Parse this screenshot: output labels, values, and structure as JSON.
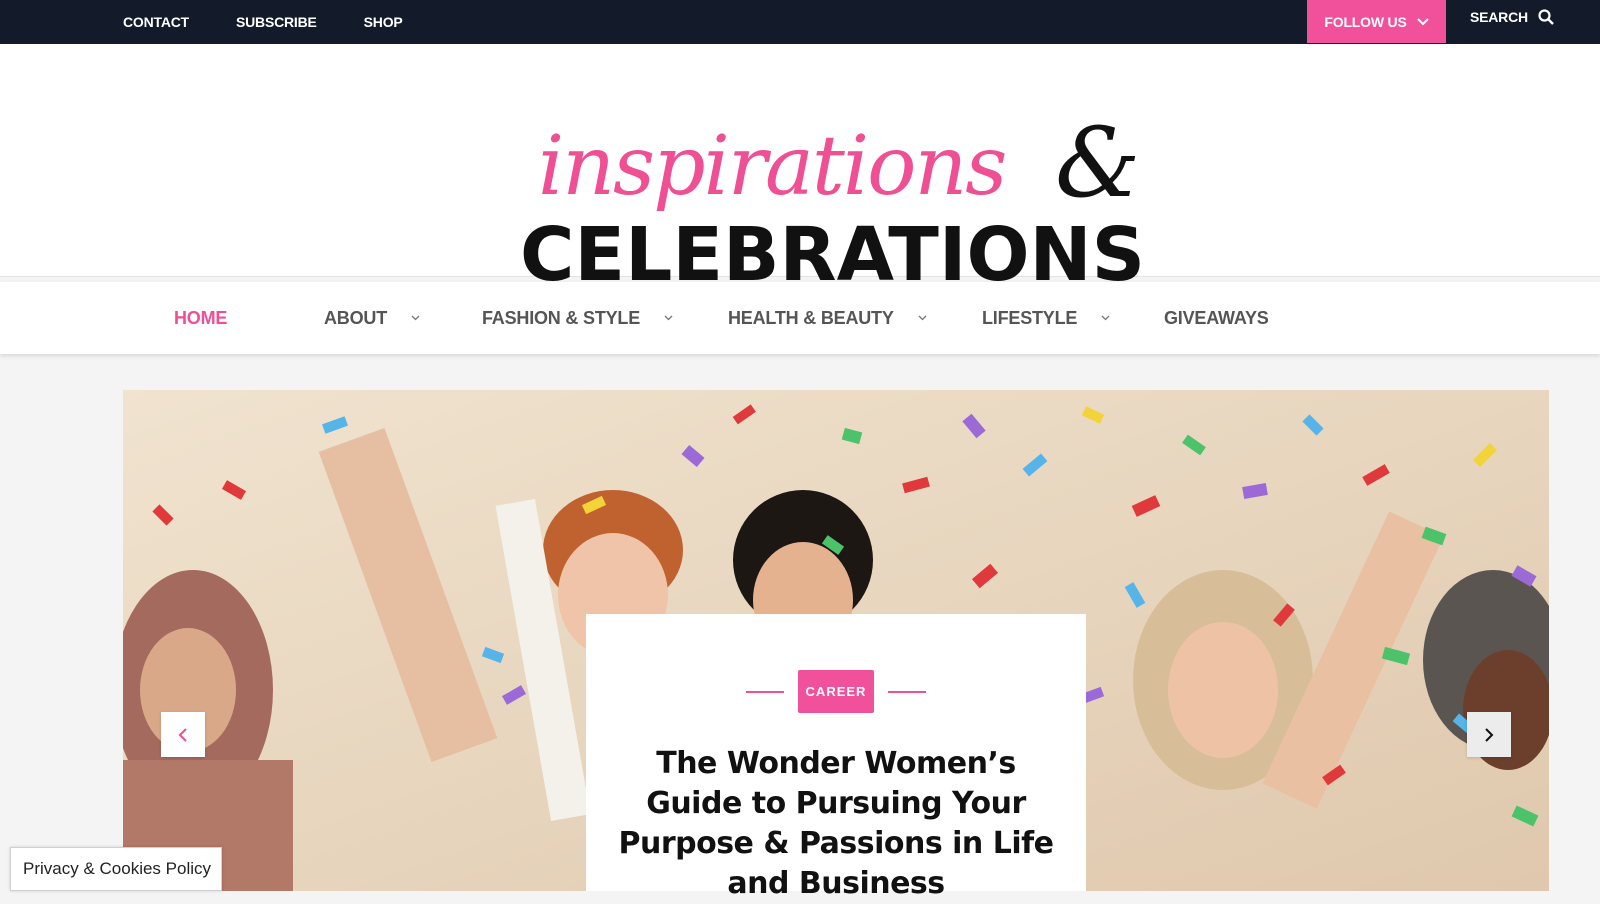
{
  "topbar": {
    "links": [
      "CONTACT",
      "SUBSCRIBE",
      "SHOP"
    ],
    "follow_label": "FOLLOW US",
    "search_label": "SEARCH"
  },
  "logo": {
    "script_text": "inspirations",
    "ampersand": "&",
    "block_text": "CELEBRATIONS",
    "script_color": "#ef4f93",
    "block_color": "#111111"
  },
  "nav": {
    "items": [
      {
        "label": "HOME",
        "active": true,
        "dropdown": false
      },
      {
        "label": "ABOUT",
        "active": false,
        "dropdown": true
      },
      {
        "label": "FASHION & STYLE",
        "active": false,
        "dropdown": true
      },
      {
        "label": "HEALTH & BEAUTY",
        "active": false,
        "dropdown": true
      },
      {
        "label": "LIFESTYLE",
        "active": false,
        "dropdown": true
      },
      {
        "label": "GIVEAWAYS",
        "active": false,
        "dropdown": false
      }
    ]
  },
  "hero": {
    "category": "CAREER",
    "title": "The Wonder Women’s Guide to Pursuing Your Purpose & Passions in Life and Business",
    "prev_icon": "chevron-left-icon",
    "next_icon": "chevron-right-icon"
  },
  "privacy": {
    "label": "Privacy & Cookies Policy"
  },
  "colors": {
    "accent": "#f0519a",
    "topbar": "#131b2a",
    "text": "#555555"
  }
}
